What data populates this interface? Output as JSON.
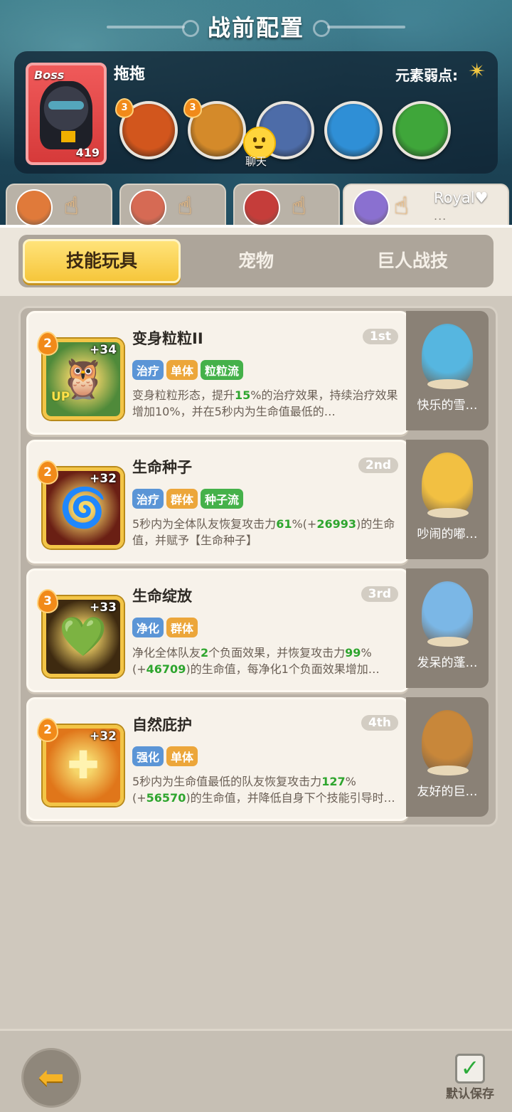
{
  "title": "战前配置",
  "boss": {
    "tag": "Boss",
    "level": "419",
    "name": "拖拖",
    "element_weakness_label": "元素弱点:",
    "element_icon": "light-star-icon",
    "skills": [
      {
        "level": "3",
        "icon": "wolf-fire-icon",
        "color": "#d2561d"
      },
      {
        "level": "3",
        "icon": "lightning-icon",
        "color": "#d48a2a"
      },
      {
        "level": "",
        "icon": "armored-beast-icon",
        "color": "#4d6ca8"
      },
      {
        "level": "",
        "icon": "hourglass-icon",
        "color": "#2f8fd6"
      },
      {
        "level": "",
        "icon": "green-slime-icon",
        "color": "#3fa63a"
      }
    ],
    "chat_label": "聊天"
  },
  "team": [
    {
      "avatar_color": "#e07a3a"
    },
    {
      "avatar_color": "#d66a54"
    },
    {
      "avatar_color": "#c53d3a"
    },
    {
      "avatar_color": "#8a70d0",
      "name": "Royal♥",
      "more": "..."
    }
  ],
  "tabs": [
    "技能玩具",
    "宠物",
    "巨人战技"
  ],
  "active_tab": 0,
  "skills": [
    {
      "level": "2",
      "bonus": "+34",
      "up": "UP",
      "title": "变身粒粒II",
      "rank": "1st",
      "tags": [
        {
          "text": "治疗",
          "color": "blue"
        },
        {
          "text": "单体",
          "color": "orange"
        },
        {
          "text": "粒粒流",
          "color": "green"
        }
      ],
      "desc_parts": [
        "变身粒粒形态，提升",
        "15",
        "%的治疗效果，持续治疗效果增加10%，并在5秒内为生命值最低的…"
      ],
      "pet_name": "快乐的雪…",
      "pet_color": "#56b6e0",
      "icon_bg": "#4f8a3a",
      "glyph": "🦉"
    },
    {
      "level": "2",
      "bonus": "+32",
      "up": "",
      "title": "生命种子",
      "rank": "2nd",
      "tags": [
        {
          "text": "治疗",
          "color": "blue"
        },
        {
          "text": "群体",
          "color": "orange"
        },
        {
          "text": "种子流",
          "color": "green"
        }
      ],
      "desc_parts": [
        "5秒内为全体队友恢复攻击力",
        "61",
        "%(+",
        "26993",
        ")的生命值，并赋予【生命种子】"
      ],
      "pet_name": "吵闹的嘟…",
      "pet_color": "#f2c042",
      "icon_bg": "#6a1f14",
      "glyph": "🌀"
    },
    {
      "level": "3",
      "bonus": "+33",
      "up": "",
      "title": "生命绽放",
      "rank": "3rd",
      "tags": [
        {
          "text": "净化",
          "color": "blue"
        },
        {
          "text": "群体",
          "color": "orange"
        }
      ],
      "desc_parts": [
        "净化全体队友",
        "2",
        "个负面效果，并恢复攻击力",
        "99",
        "%(+",
        "46709",
        ")的生命值，每净化1个负面效果增加…"
      ],
      "pet_name": "发呆的蓬…",
      "pet_color": "#7bb7e6",
      "icon_bg": "#3e2a10",
      "glyph": "💚"
    },
    {
      "level": "2",
      "bonus": "+32",
      "up": "",
      "title": "自然庇护",
      "rank": "4th",
      "tags": [
        {
          "text": "强化",
          "color": "blue"
        },
        {
          "text": "单体",
          "color": "orange"
        }
      ],
      "desc_parts": [
        "5秒内为生命值最低的队友恢复攻击力",
        "127",
        "%(+",
        "56570",
        ")的生命值，并降低自身下个技能引导时…"
      ],
      "pet_name": "友好的巨…",
      "pet_color": "#c8873a",
      "icon_bg": "#e0761a",
      "glyph": "✚"
    }
  ],
  "footer": {
    "back_icon": "back-arrow-icon",
    "save_label": "默认保存",
    "save_icon": "checkbox-checked-icon"
  }
}
